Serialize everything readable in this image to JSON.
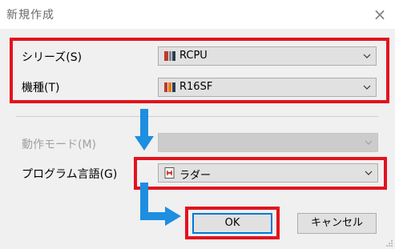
{
  "dialog": {
    "title": "新規作成",
    "close_glyph": "×"
  },
  "series": {
    "label": "シリーズ(S)",
    "value": "RCPU",
    "icon": "rcpu-module-icon"
  },
  "model": {
    "label": "機種(T)",
    "value": "R16SF",
    "icon": "safety-cpu-icon"
  },
  "operation_mode": {
    "label": "動作モード(M)",
    "value": "",
    "disabled": true
  },
  "program_language": {
    "label": "プログラム言語(G)",
    "value": "ラダー",
    "icon": "ladder-program-icon"
  },
  "buttons": {
    "ok": "OK",
    "cancel": "キャンセル"
  },
  "colors": {
    "highlight": "#e3121e",
    "arrow": "#1e8ee0",
    "focus": "#0078d7"
  }
}
